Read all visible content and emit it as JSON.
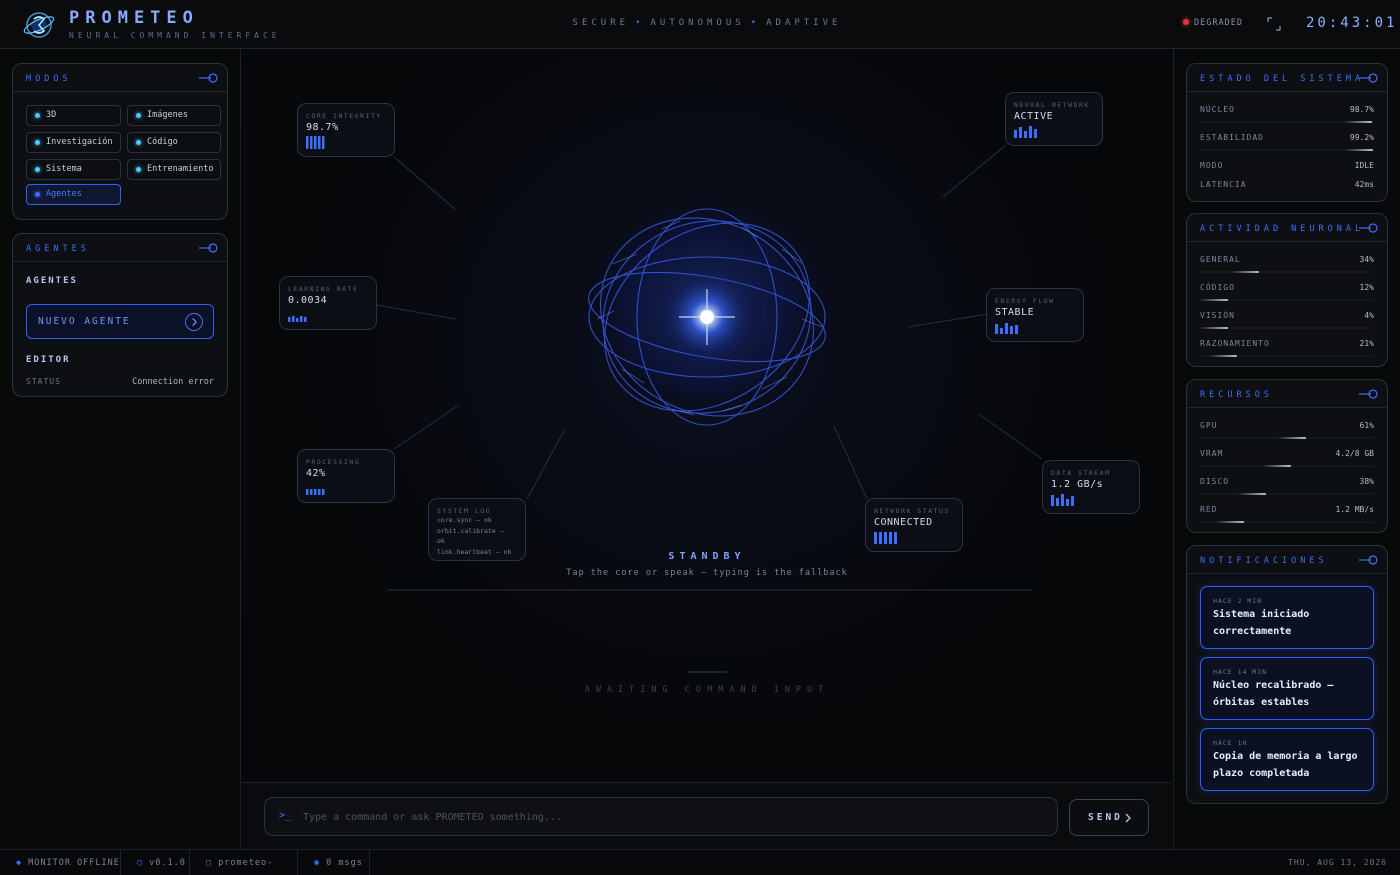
{
  "header": {
    "brand": "PROMETEO",
    "subtitle": "NEURAL COMMAND INTERFACE",
    "tagline": [
      "SECURE",
      "AUTONOMOUS",
      "ADAPTIVE"
    ],
    "status": "DEGRADED",
    "clock": "20:43:01"
  },
  "modes": {
    "title": "MODOS",
    "items": [
      {
        "label": "3D",
        "active": false
      },
      {
        "label": "Imágenes",
        "active": false
      },
      {
        "label": "Investigación",
        "active": false
      },
      {
        "label": "Código",
        "active": false
      },
      {
        "label": "Sistema",
        "active": false
      },
      {
        "label": "Entrenamiento",
        "active": false
      },
      {
        "label": "Agentes",
        "active": true
      }
    ]
  },
  "agents": {
    "title": "AGENTES",
    "heading": "AGENTES",
    "new_agent": "NUEVO AGENTE",
    "editor_label": "EDITOR",
    "status_label": "STATUS",
    "status_value": "Connection error"
  },
  "hud": {
    "core_integrity": {
      "label": "CORE INTEGRITY",
      "value": "98.7%"
    },
    "neural_network": {
      "label": "NEURAL NETWORK",
      "value": "ACTIVE"
    },
    "learning_rate": {
      "label": "LEARNING RATE",
      "value": "0.0034"
    },
    "energy_flow": {
      "label": "ENERGY FLOW",
      "value": "STABLE"
    },
    "processing": {
      "label": "PROCESSING",
      "value": "42%"
    },
    "data_stream": {
      "label": "DATA STREAM",
      "value": "1.2 GB/s"
    },
    "system_log": {
      "label": "SYSTEM LOG",
      "lines": [
        "core.sync — ok",
        "orbit.calibrate —",
        "ok",
        "link.heartbeat — ok"
      ]
    },
    "network_status": {
      "label": "NETWORK STATUS",
      "value": "CONNECTED"
    }
  },
  "center": {
    "standby": "STANDBY",
    "hint": "Tap the core or speak — typing is the fallback",
    "awaiting": "AWAITING COMMAND INPUT"
  },
  "command": {
    "prompt": ">_",
    "placeholder": "Type a command or ask PROMETEO something...",
    "send": "SEND"
  },
  "system_state": {
    "title": "ESTADO DEL SISTEMA",
    "rows": [
      {
        "name": "NÚCLEO",
        "value": "98.7%",
        "level": 0.987
      },
      {
        "name": "ESTABILIDAD",
        "value": "99.2%",
        "level": 0.992
      },
      {
        "name": "MODO",
        "value": "IDLE"
      },
      {
        "name": "LATENCIA",
        "value": "42ms"
      }
    ]
  },
  "neural_activity": {
    "title": "ACTIVIDAD NEURONAL",
    "rows": [
      {
        "name": "GENERAL",
        "value": "34%",
        "level": 0.34
      },
      {
        "name": "CÓDIGO",
        "value": "12%",
        "level": 0.12
      },
      {
        "name": "VISIÓN",
        "value": "4%",
        "level": 0.04
      },
      {
        "name": "RAZONAMIENTO",
        "value": "21%",
        "level": 0.21
      }
    ]
  },
  "resources": {
    "title": "RECURSOS",
    "rows": [
      {
        "name": "GPU",
        "value": "61%",
        "level": 0.61
      },
      {
        "name": "VRAM",
        "value": "4.2/8 GB",
        "level": 0.525
      },
      {
        "name": "DISCO",
        "value": "38%",
        "level": 0.38
      },
      {
        "name": "RED",
        "value": "1.2 MB/s",
        "level": 0.25
      }
    ]
  },
  "notifications": {
    "title": "NOTIFICACIONES",
    "items": [
      {
        "time": "HACE 2 MIN",
        "text": "Sistema iniciado correctamente"
      },
      {
        "time": "HACE 14 MIN",
        "text": "Núcleo recalibrado — órbitas estables"
      },
      {
        "time": "HACE 1H",
        "text": "Copia de memoria a largo plazo completada"
      }
    ]
  },
  "footer": {
    "monitor": "MONITOR OFFLINE",
    "version": "v0.1.0",
    "project": "prometeo-core",
    "messages": "0 msgs",
    "date": "THU, AUG 13, 2026"
  },
  "colors": {
    "accent": "#3d6fff",
    "alert": "#e0353f",
    "background": "#060708"
  }
}
